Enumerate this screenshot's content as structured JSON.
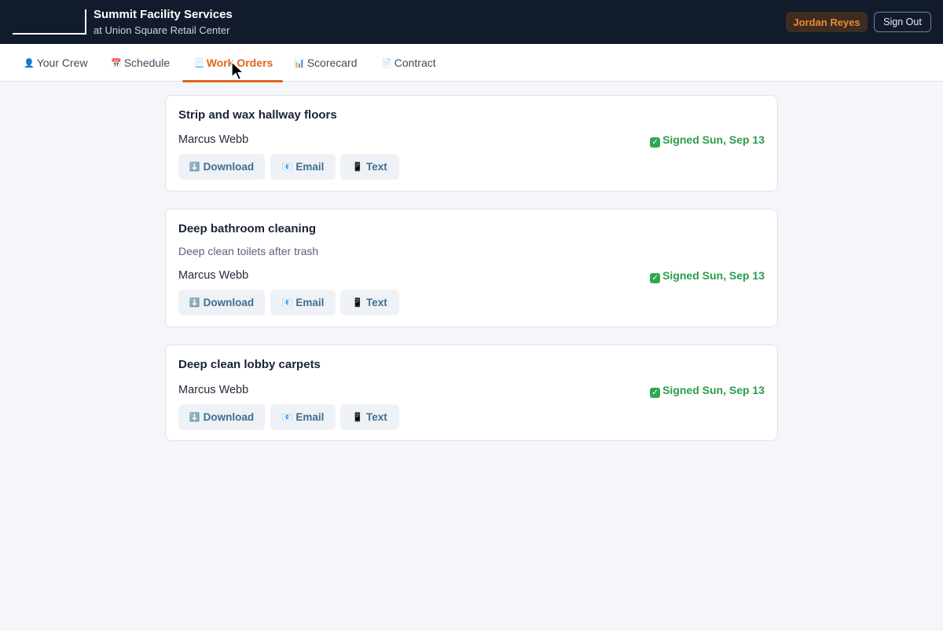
{
  "header": {
    "company": "Summit Facility Services",
    "location": "at Union Square Retail Center",
    "user_name": "Jordan Reyes",
    "sign_out_label": "Sign Out"
  },
  "nav": {
    "tabs": [
      {
        "label": "Your Crew",
        "icon": "👤"
      },
      {
        "label": "Schedule",
        "icon": "📅"
      },
      {
        "label": "Work Orders",
        "icon": "📃",
        "active": true
      },
      {
        "label": "Scorecard",
        "icon": "📊"
      },
      {
        "label": "Contract",
        "icon": "📄"
      }
    ]
  },
  "actions": {
    "download": {
      "label": "Download",
      "icon": "⬇️"
    },
    "email": {
      "label": "Email",
      "icon": "📧"
    },
    "text": {
      "label": "Text",
      "icon": "📱"
    }
  },
  "work_orders": [
    {
      "title": "Strip and wax hallway floors",
      "description": "",
      "assignee": "Marcus Webb",
      "status": "Signed Sun, Sep 13",
      "status_icon": "✓"
    },
    {
      "title": "Deep bathroom cleaning",
      "description": "Deep clean toilets after trash",
      "assignee": "Marcus Webb",
      "status": "Signed Sun, Sep 13",
      "status_icon": "✓"
    },
    {
      "title": "Deep clean lobby carpets",
      "description": "",
      "assignee": "Marcus Webb",
      "status": "Signed Sun, Sep 13",
      "status_icon": "✓"
    }
  ],
  "colors": {
    "header_bg": "#111b2b",
    "accent": "#e0651c",
    "signed": "#2a9d4a",
    "action_text": "#3f6f93"
  }
}
